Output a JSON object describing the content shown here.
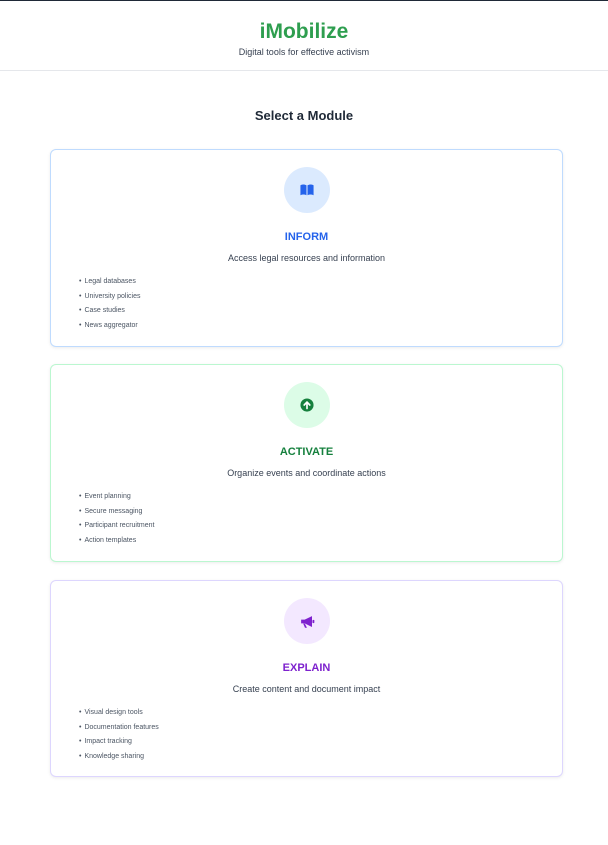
{
  "header": {
    "title": "iMobilize",
    "subtitle": "Digital tools for effective activism",
    "title_color": "#2e9e4f"
  },
  "main": {
    "heading": "Select a Module"
  },
  "modules": [
    {
      "title": "INFORM",
      "description": "Access legal resources and information",
      "icon": "book-icon",
      "accent": "#2563eb",
      "icon_bg": "#dbeafe",
      "features": [
        "Legal databases",
        "University policies",
        "Case studies",
        "News aggregator"
      ]
    },
    {
      "title": "ACTIVATE",
      "description": "Organize events and coordinate actions",
      "icon": "arrow-up-circle-icon",
      "accent": "#15803d",
      "icon_bg": "#dcfce7",
      "features": [
        "Event planning",
        "Secure messaging",
        "Participant recruitment",
        "Action templates"
      ]
    },
    {
      "title": "EXPLAIN",
      "description": "Create content and document impact",
      "icon": "megaphone-icon",
      "accent": "#7e22ce",
      "icon_bg": "#f3e8ff",
      "features": [
        "Visual design tools",
        "Documentation features",
        "Impact tracking",
        "Knowledge sharing"
      ]
    }
  ]
}
